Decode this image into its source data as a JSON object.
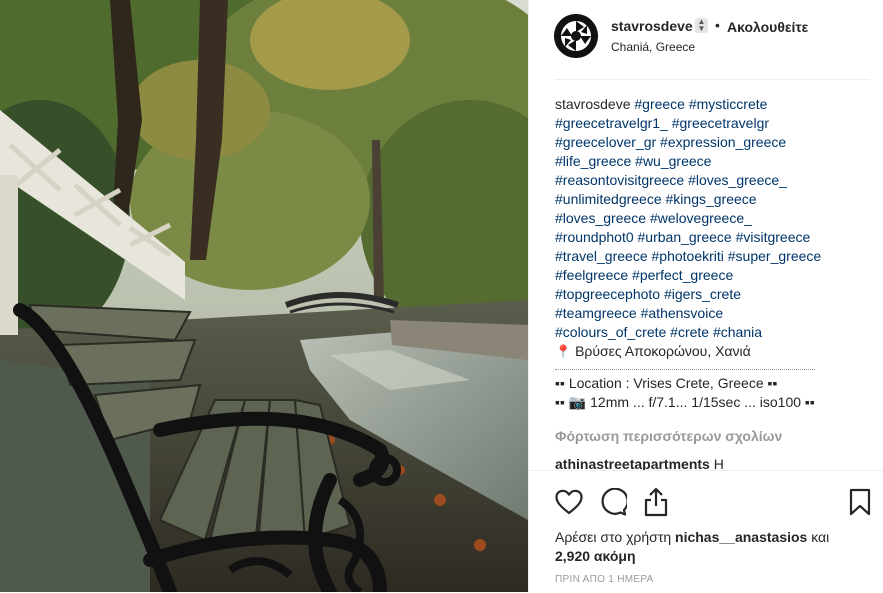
{
  "post": {
    "photo_alt": "",
    "header": {
      "username": "stavrosdeve",
      "separator": "•",
      "follow_label": "Ακολουθείτε",
      "location": "Chaniá, Greece"
    },
    "caption": {
      "username": "stavrosdeve",
      "lines": [
        "#greece #mysticcrete",
        "#greecetravelgr1_ #greecetravelgr",
        "#greecelover_gr #expression_greece",
        "#life_greece #wu_greece",
        "#reasontovisitgreece #loves_greece_",
        "#unlimitedgreece #kings_greece",
        "#loves_greece #welovegreece_",
        "#roundphot0 #urban_greece #visitgreece",
        "#travel_greece #photoekriti #super_greece",
        "#feelgreece #perfect_greece",
        "#topgreecephoto #igers_crete",
        "#teamgreece #athensvoice",
        "#colours_of_crete #crete #chania"
      ],
      "place_line": "Βρύσες Αποκορώνου, Χανιά",
      "location_line": "▪▪ Location : Vrises Crete, Greece ▪▪",
      "camera_line": "▪▪ 📷 12mm ... f/7.1... 1/15sec ... iso100 ▪▪"
    },
    "load_more_label": "Φόρτωση περισσότερων σχολίων",
    "comment": {
      "username": "athinastreetapartments",
      "text": "Η"
    },
    "likes": {
      "prefix": "Αρέσει στο χρήστη",
      "user": "nichas__anastasios",
      "conjunction": "και",
      "count": "2,920 ακόμη"
    },
    "timestamp": "ΠΡΙΝ ΑΠΟ 1 ΗΜΕΡΑ",
    "icons": {
      "like": "heart-icon",
      "comment": "comment-icon",
      "share": "share-icon",
      "save": "bookmark-icon",
      "pin": "round-pushpin-icon",
      "camera": "camera-icon"
    },
    "colors": {
      "hashtag": "#003569",
      "text": "#262626",
      "muted": "#999999"
    }
  }
}
